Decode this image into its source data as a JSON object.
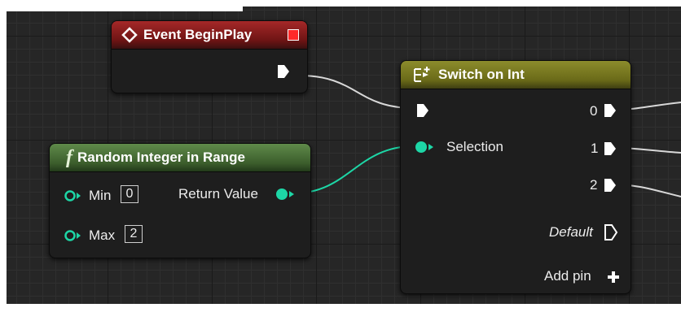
{
  "event_node": {
    "title": "Event BeginPlay"
  },
  "random_node": {
    "title": "Random Integer in Range",
    "min_label": "Min",
    "min_value": "0",
    "max_label": "Max",
    "max_value": "2",
    "return_label": "Return Value"
  },
  "switch_node": {
    "title": "Switch on Int",
    "selection_label": "Selection",
    "outputs": [
      "0",
      "1",
      "2"
    ],
    "default_label": "Default",
    "add_pin_label": "Add pin"
  },
  "colors": {
    "integer_pin": "#1dd6a6",
    "event_header": "#a52828",
    "function_header": "#4e7a3c",
    "macro_header": "#8c8c2c"
  },
  "icons": [
    "event-diamond-icon",
    "function-f-icon",
    "switch-icon",
    "exec-arrow-icon",
    "plus-icon"
  ]
}
